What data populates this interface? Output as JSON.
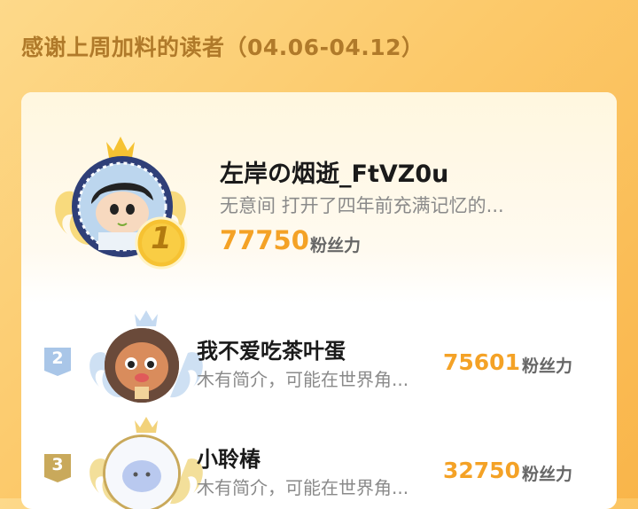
{
  "header": {
    "title": "感谢上周加料的读者（04.06-04.12）"
  },
  "readers": [
    {
      "rank": "1",
      "name": "左岸の烟逝_FtVZ0u",
      "bio": "无意间 打开了四年前充满记忆的...",
      "fans": "77750",
      "unit": "粉丝力"
    },
    {
      "rank": "2",
      "name": "我不爱吃茶叶蛋",
      "bio": "木有简介，可能在世界角...",
      "fans": "75601",
      "unit": "粉丝力"
    },
    {
      "rank": "3",
      "name": "小聆椿",
      "bio": "木有简介，可能在世界角...",
      "fans": "32750",
      "unit": "粉丝力"
    }
  ],
  "colors": {
    "accent": "#f4a226",
    "title": "#b07a2a",
    "gold": "#f6c232",
    "silver": "#a9c6e8",
    "bronze": "#c9a95b"
  },
  "icons": [
    "crown-icon",
    "wings-icon",
    "rank-badge-icon"
  ]
}
